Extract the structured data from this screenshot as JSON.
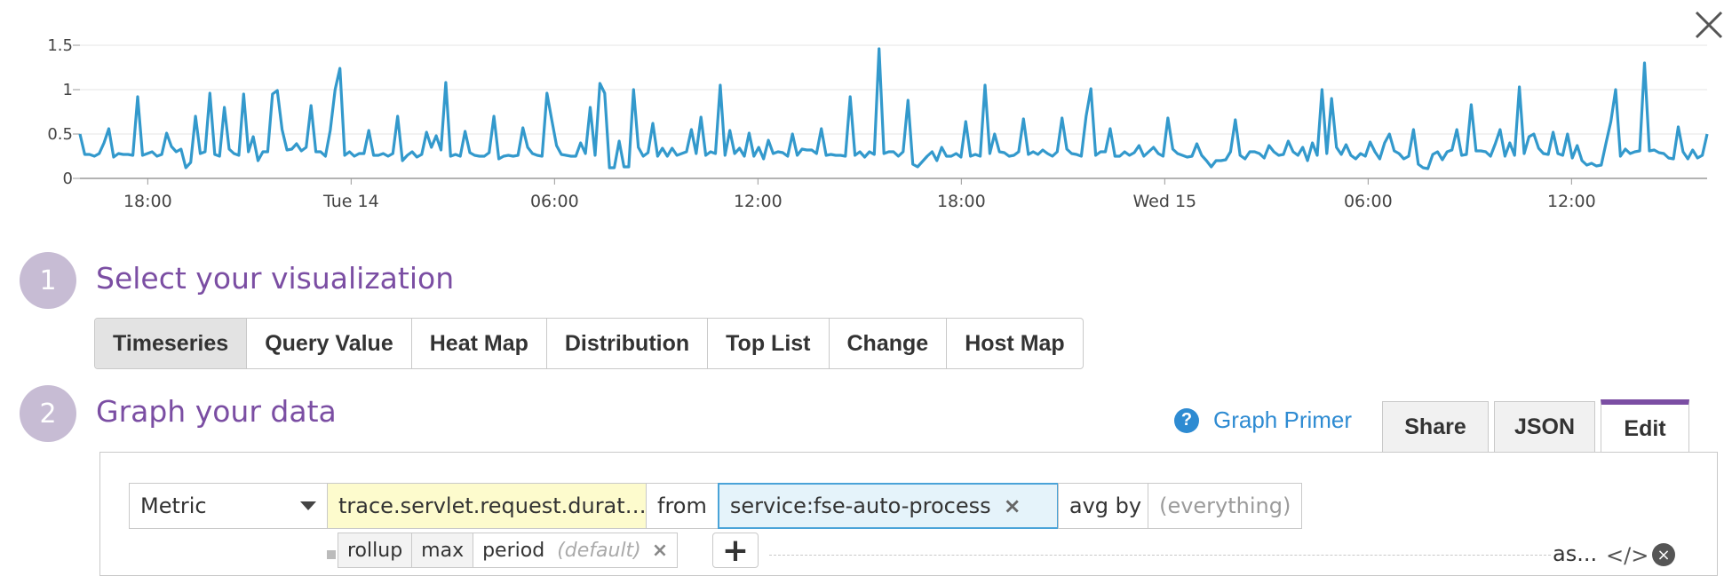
{
  "colors": {
    "accent": "#7b4ea3",
    "series": "#3399cc",
    "link": "#2e8bd2",
    "scope_bg": "#e5f3fa",
    "metric_bg": "#fdfbcd"
  },
  "icons": {
    "close": "close-icon",
    "help": "question-circle-icon",
    "caret": "caret-down-icon",
    "plus": "plus-icon",
    "code": "code-icon",
    "remove": "remove-circle-icon"
  },
  "chart_data": {
    "type": "line",
    "ylim": [
      0,
      1.5
    ],
    "y_ticks": [
      "0",
      "0.5",
      "1",
      "1.5"
    ],
    "x_ticks": [
      "18:00",
      "Tue 14",
      "06:00",
      "12:00",
      "18:00",
      "Wed 15",
      "06:00",
      "12:00"
    ],
    "x_tick_hours": [
      2,
      8,
      14,
      20,
      26,
      32,
      38,
      44
    ],
    "x_range_hours": [
      0,
      48
    ],
    "grid": true,
    "series": [
      {
        "values": [
          0.5,
          0.27,
          0.27,
          0.25,
          0.28,
          0.4,
          0.56,
          0.24,
          0.28,
          0.27,
          0.27,
          0.26,
          0.92,
          0.26,
          0.28,
          0.3,
          0.25,
          0.27,
          0.51,
          0.36,
          0.3,
          0.33,
          0.12,
          0.18,
          0.7,
          0.28,
          0.3,
          0.96,
          0.27,
          0.25,
          0.8,
          0.33,
          0.28,
          0.26,
          0.95,
          0.3,
          0.47,
          0.2,
          0.3,
          0.3,
          0.95,
          0.99,
          0.55,
          0.32,
          0.33,
          0.39,
          0.31,
          0.35,
          0.82,
          0.3,
          0.3,
          0.25,
          0.54,
          1.0,
          1.24,
          0.26,
          0.3,
          0.25,
          0.28,
          0.28,
          0.54,
          0.26,
          0.26,
          0.28,
          0.25,
          0.28,
          0.7,
          0.2,
          0.26,
          0.3,
          0.24,
          0.27,
          0.52,
          0.35,
          0.48,
          0.32,
          1.08,
          0.25,
          0.27,
          0.25,
          0.53,
          0.29,
          0.26,
          0.25,
          0.25,
          0.29,
          0.7,
          0.22,
          0.25,
          0.26,
          0.25,
          0.26,
          0.57,
          0.35,
          0.28,
          0.26,
          0.25,
          0.96,
          0.66,
          0.37,
          0.27,
          0.26,
          0.25,
          0.25,
          0.4,
          0.28,
          0.8,
          0.26,
          1.07,
          0.96,
          0.12,
          0.12,
          0.42,
          0.13,
          0.13,
          1.0,
          0.35,
          0.25,
          0.29,
          0.62,
          0.25,
          0.34,
          0.25,
          0.34,
          0.26,
          0.28,
          0.3,
          0.55,
          0.28,
          0.69,
          0.26,
          0.3,
          0.28,
          1.05,
          0.26,
          0.54,
          0.28,
          0.34,
          0.25,
          0.51,
          0.25,
          0.35,
          0.22,
          0.43,
          0.28,
          0.3,
          0.29,
          0.25,
          0.5,
          0.26,
          0.33,
          0.32,
          0.32,
          0.28,
          0.56,
          0.26,
          0.27,
          0.26,
          0.26,
          0.25,
          0.92,
          0.26,
          0.3,
          0.24,
          0.3,
          0.27,
          1.46,
          0.28,
          0.3,
          0.3,
          0.25,
          0.3,
          0.88,
          0.16,
          0.13,
          0.19,
          0.25,
          0.3,
          0.2,
          0.35,
          0.25,
          0.25,
          0.28,
          0.24,
          0.64,
          0.25,
          0.27,
          0.25,
          1.05,
          0.28,
          0.5,
          0.3,
          0.29,
          0.25,
          0.26,
          0.3,
          0.67,
          0.27,
          0.3,
          0.27,
          0.32,
          0.28,
          0.25,
          0.3,
          0.68,
          0.33,
          0.28,
          0.27,
          0.25,
          0.7,
          1.01,
          0.26,
          0.3,
          0.3,
          0.56,
          0.25,
          0.25,
          0.3,
          0.26,
          0.29,
          0.37,
          0.25,
          0.3,
          0.35,
          0.28,
          0.25,
          0.68,
          0.33,
          0.28,
          0.26,
          0.24,
          0.25,
          0.39,
          0.26,
          0.2,
          0.13,
          0.2,
          0.2,
          0.21,
          0.3,
          0.66,
          0.26,
          0.22,
          0.3,
          0.3,
          0.28,
          0.23,
          0.37,
          0.3,
          0.26,
          0.27,
          0.42,
          0.3,
          0.26,
          0.35,
          0.2,
          0.4,
          0.26,
          1.0,
          0.28,
          0.9,
          0.35,
          0.27,
          0.38,
          0.26,
          0.22,
          0.28,
          0.25,
          0.41,
          0.3,
          0.22,
          0.4,
          0.5,
          0.31,
          0.28,
          0.22,
          0.25,
          0.55,
          0.16,
          0.12,
          0.11,
          0.27,
          0.3,
          0.21,
          0.3,
          0.32,
          0.55,
          0.26,
          0.27,
          0.83,
          0.31,
          0.31,
          0.3,
          0.25,
          0.39,
          0.55,
          0.25,
          0.4,
          0.26,
          1.03,
          0.28,
          0.47,
          0.5,
          0.34,
          0.28,
          0.27,
          0.52,
          0.28,
          0.26,
          0.5,
          0.23,
          0.37,
          0.2,
          0.15,
          0.17,
          0.14,
          0.15,
          0.4,
          0.64,
          1.0,
          0.25,
          0.33,
          0.28,
          0.3,
          0.31,
          1.3,
          0.31,
          0.32,
          0.29,
          0.28,
          0.23,
          0.22,
          0.58,
          0.3,
          0.22,
          0.32,
          0.23,
          0.26,
          0.5
        ]
      }
    ]
  },
  "steps": [
    {
      "number": "1",
      "title": "Select your visualization"
    },
    {
      "number": "2",
      "title": "Graph your data"
    }
  ],
  "viz_tabs": [
    "Timeseries",
    "Query Value",
    "Heat Map",
    "Distribution",
    "Top List",
    "Change",
    "Host Map"
  ],
  "graph_primer": {
    "icon": "?",
    "label": "Graph Primer"
  },
  "editor_tabs": [
    "Share",
    "JSON",
    "Edit"
  ],
  "query": {
    "source": "Metric",
    "metric": "trace.servlet.request.durat…",
    "from_label": "from",
    "scope": "service:fse-auto-process",
    "scope_remove": "×",
    "avg_by": "avg by",
    "everything": "(everything)"
  },
  "functions": {
    "rollup": "rollup",
    "max": "max",
    "period": "period",
    "default": "(default)",
    "remove": "×",
    "plus": "+",
    "as": "as...",
    "code": "</>",
    "remove_query": "×"
  }
}
